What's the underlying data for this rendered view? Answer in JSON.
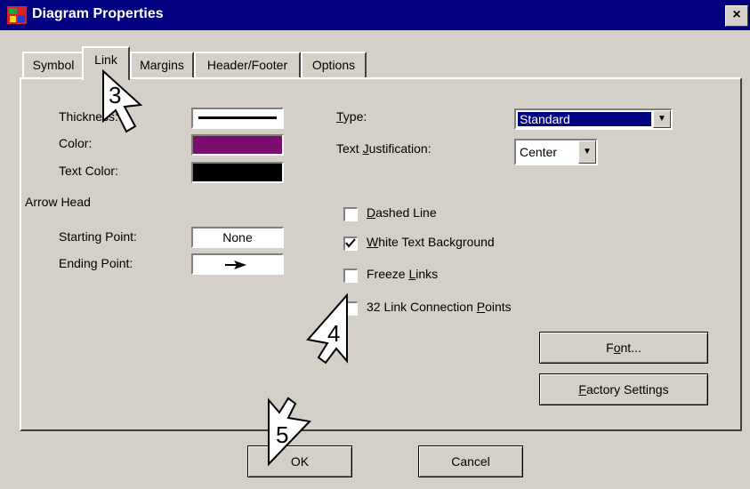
{
  "window": {
    "title": "Diagram Properties",
    "close_glyph": "×"
  },
  "tabs": [
    {
      "label": "Symbol"
    },
    {
      "label": "Link"
    },
    {
      "label": "Margins"
    },
    {
      "label": "Header/Footer"
    },
    {
      "label": "Options"
    }
  ],
  "link": {
    "thickness_label": "Thickness:",
    "color_label": "Color:",
    "text_color_label": "Text Color:",
    "color_value": "#7b0d6e",
    "text_color_value": "#000000",
    "arrow_head_label": "Arrow Head",
    "starting_point_label": "Starting Point:",
    "starting_point_value": "None",
    "ending_point_label": "Ending Point:",
    "type_label": "Type:",
    "type_value": "Standard",
    "justification_label": "Text Justification:",
    "justification_value": "Center",
    "options": [
      {
        "label": "Dashed Line",
        "checked": false
      },
      {
        "label": "White Text Background",
        "checked": true
      },
      {
        "label": "Freeze Links",
        "checked": false
      },
      {
        "label": "32 Link Connection Points",
        "checked": false
      }
    ],
    "font_button": "Font...",
    "factory_button": "Factory Settings"
  },
  "footer": {
    "ok": "OK",
    "cancel": "Cancel"
  },
  "annotations": {
    "step3": "3",
    "step4": "4",
    "step5": "5"
  },
  "colors": {
    "titlebar": "#000080",
    "face": "#d4d0c8",
    "selection": "#000080"
  }
}
